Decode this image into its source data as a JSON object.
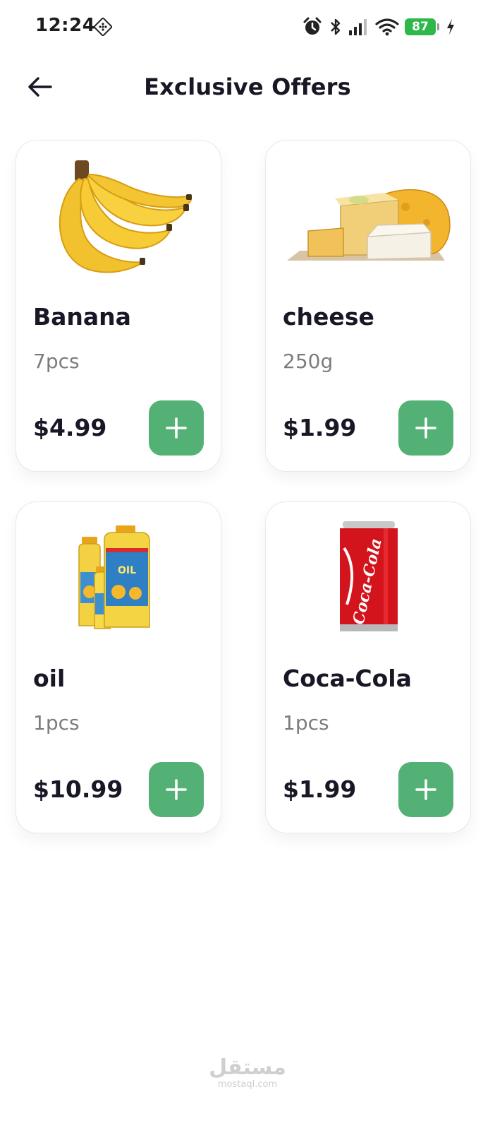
{
  "status_bar": {
    "time": "12:24",
    "battery": "87",
    "icons": [
      "nfc-icon",
      "alarm-icon",
      "bluetooth-icon",
      "signal-icon",
      "wifi-icon",
      "battery-icon",
      "charging-icon"
    ]
  },
  "header": {
    "title": "Exclusive Offers",
    "back_icon": "arrow-left-icon"
  },
  "products": [
    {
      "name": "Banana",
      "quantity": "7pcs",
      "price": "$4.99",
      "image": "banana-image"
    },
    {
      "name": "cheese",
      "quantity": "250g",
      "price": "$1.99",
      "image": "cheese-image"
    },
    {
      "name": "oil",
      "quantity": "1pcs",
      "price": "$10.99",
      "image": "oil-bottles-image"
    },
    {
      "name": "Coca-Cola",
      "quantity": "1pcs",
      "price": "$1.99",
      "image": "coca-cola-can-image"
    }
  ],
  "watermark": {
    "arabic": "مستقل",
    "latin": "mostaql.com"
  },
  "colors": {
    "accent_green": "#53b175",
    "text_dark": "#181725",
    "text_muted": "#7c7c7c",
    "card_border": "#e8e8e8",
    "battery_green": "#2fb84a"
  }
}
